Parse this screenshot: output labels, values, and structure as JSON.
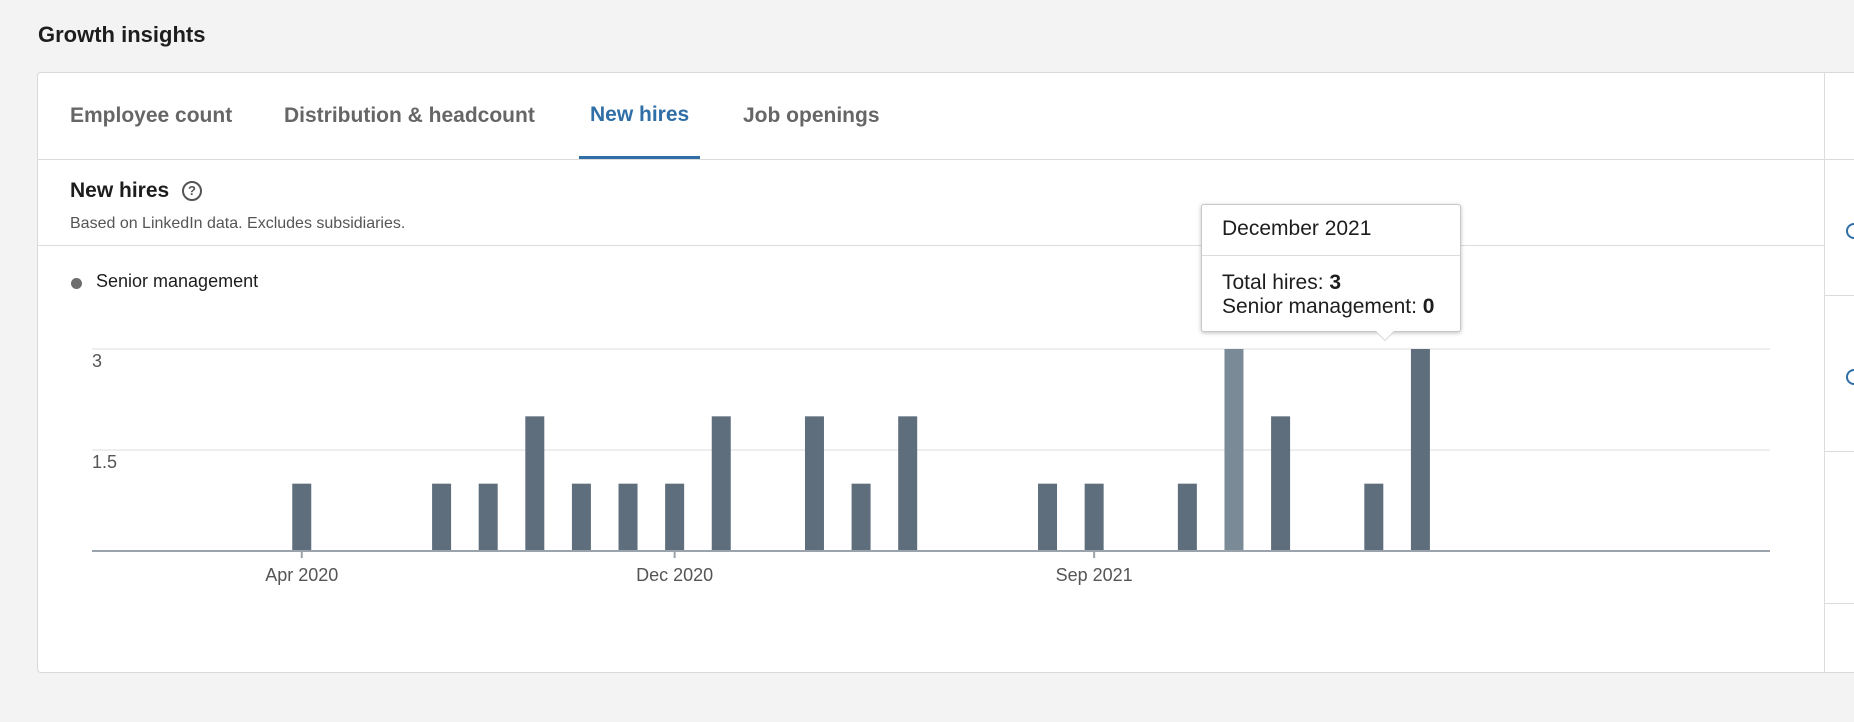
{
  "section_title": "Growth insights",
  "tabs": [
    {
      "label": "Employee count",
      "active": false
    },
    {
      "label": "Distribution & headcount",
      "active": false
    },
    {
      "label": "New hires",
      "active": true
    },
    {
      "label": "Job openings",
      "active": false
    }
  ],
  "panel": {
    "title": "New hires",
    "help_icon": "question-circle-icon",
    "subtitle": "Based on LinkedIn data. Excludes subsidiaries."
  },
  "legend": [
    {
      "label": "Senior management",
      "color": "#6d6d6d"
    }
  ],
  "tooltip": {
    "title": "December 2021",
    "rows": [
      {
        "label": "Total hires: ",
        "value": "3"
      },
      {
        "label": "Senior management: ",
        "value": "0"
      }
    ]
  },
  "colors": {
    "bar": "#5f6e7c",
    "bar_highlight": "#7b8a97",
    "accent": "#2f6ea6",
    "grid": "#dcdcdc"
  },
  "chart_data": {
    "type": "bar",
    "title": "New hires",
    "xlabel": "",
    "ylabel": "",
    "ylim": [
      0,
      3
    ],
    "yticks": [
      1.5,
      3
    ],
    "xticks": [
      {
        "label": "Apr 2020",
        "x": "2020-04"
      },
      {
        "label": "Dec 2020",
        "x": "2020-12"
      },
      {
        "label": "Sep 2021",
        "x": "2021-09"
      }
    ],
    "x_range": [
      "2019-12",
      "2022-11"
    ],
    "grid": true,
    "highlighted": "2021-12",
    "categories": [
      "2020-04",
      "2020-07",
      "2020-08",
      "2020-09",
      "2020-10",
      "2020-11",
      "2020-12",
      "2021-01",
      "2021-03",
      "2021-04",
      "2021-05",
      "2021-08",
      "2021-09",
      "2021-11",
      "2021-12",
      "2022-01",
      "2022-03",
      "2022-04"
    ],
    "series": [
      {
        "values": [
          1,
          1,
          1,
          2,
          1,
          1,
          1,
          2,
          2,
          1,
          2,
          1,
          1,
          1,
          3,
          2,
          1,
          3
        ]
      }
    ]
  }
}
